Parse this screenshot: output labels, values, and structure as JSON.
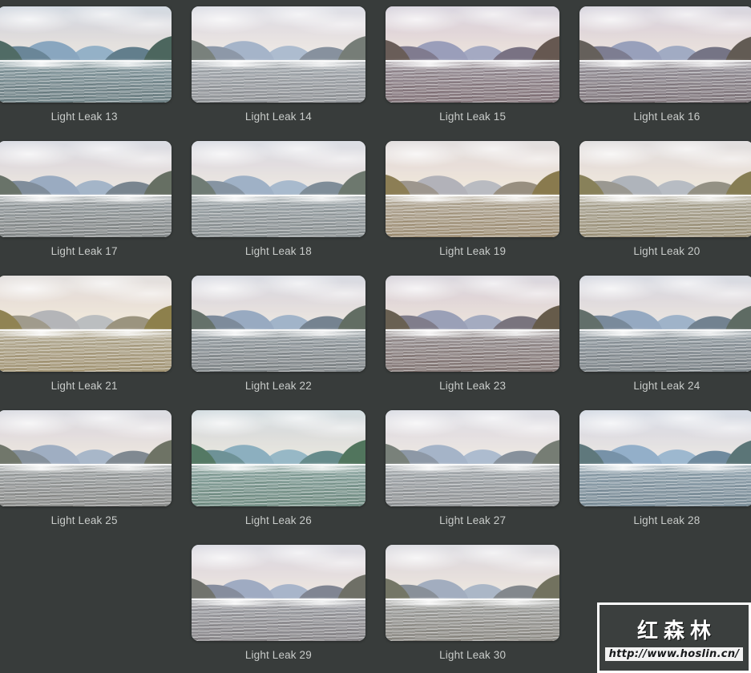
{
  "background_color": "#383c3b",
  "label_color": "#c9ccca",
  "gallery": {
    "columns": 4,
    "rows": 5,
    "items": [
      {
        "label": "Light Leak 13",
        "leak_color": "#b8fff0",
        "leak_pos": "72% 42%",
        "leak_size": "34%",
        "tone": "rgba(120,220,210,0.18)"
      },
      {
        "label": "Light Leak 14",
        "leak_color": "#ffffff",
        "leak_pos": "38% 48%",
        "leak_size": "95%",
        "tone": "rgba(255,240,235,0.30)"
      },
      {
        "label": "Light Leak 15",
        "leak_color": "#ff4d4d",
        "leak_pos": "26% 48%",
        "leak_size": "52%",
        "tone": "rgba(255,90,90,0.22)"
      },
      {
        "label": "Light Leak 16",
        "leak_color": "#ffffff",
        "leak_pos": "58% 42%",
        "leak_size": "58%",
        "tone": "rgba(255,120,120,0.20)"
      },
      {
        "label": "Light Leak 17",
        "leak_color": "#fff0c8",
        "leak_pos": "6% 55%",
        "leak_size": "60%",
        "tone": "rgba(255,235,200,0.22)"
      },
      {
        "label": "Light Leak 18",
        "leak_color": "#ffffff",
        "leak_pos": "78% 40%",
        "leak_size": "70%",
        "tone": "rgba(250,250,230,0.26)"
      },
      {
        "label": "Light Leak 19",
        "leak_color": "#ffc400",
        "leak_pos": "14% 40%",
        "leak_size": "62%",
        "tone": "rgba(255,170,40,0.40)"
      },
      {
        "label": "Light Leak 20",
        "leak_color": "#ffffff",
        "leak_pos": "16% 52%",
        "leak_size": "48%",
        "tone": "rgba(255,190,60,0.38)"
      },
      {
        "label": "Light Leak 21",
        "leak_color": "#ffd000",
        "leak_pos": "50% 72%",
        "leak_size": "56%",
        "tone": "rgba(255,180,30,0.42)"
      },
      {
        "label": "Light Leak 22",
        "leak_color": "#ffffff",
        "leak_pos": "18% 40%",
        "leak_size": "40%",
        "tone": "rgba(255,245,225,0.20)"
      },
      {
        "label": "Light Leak 23",
        "leak_color": "#ff6a2a",
        "leak_pos": "16% 46%",
        "leak_size": "34%",
        "tone": "rgba(255,110,50,0.22)"
      },
      {
        "label": "Light Leak 24",
        "leak_color": "#ffffff",
        "leak_pos": "22% 58%",
        "leak_size": "32%",
        "tone": "rgba(255,255,250,0.18)"
      },
      {
        "label": "Light Leak 25",
        "leak_color": "#ffffff",
        "leak_pos": "18% 62%",
        "leak_size": "62%",
        "tone": "rgba(255,225,180,0.26)"
      },
      {
        "label": "Light Leak 26",
        "leak_color": "#7dff9b",
        "leak_pos": "16% 55%",
        "leak_size": "30%",
        "tone": "rgba(110,235,140,0.26)"
      },
      {
        "label": "Light Leak 27",
        "leak_color": "#ffffff",
        "leak_pos": "44% 48%",
        "leak_size": "62%",
        "tone": "rgba(255,240,225,0.30)"
      },
      {
        "label": "Light Leak 28",
        "leak_color": "#bfe8ff",
        "leak_pos": "68% 58%",
        "leak_size": "55%",
        "tone": "rgba(150,215,255,0.28)"
      },
      {
        "label": "Light Leak 29",
        "leak_color": "#fff3d0",
        "leak_pos": "10% 58%",
        "leak_size": "48%",
        "tone": "rgba(255,200,190,0.26)"
      },
      {
        "label": "Light Leak 30",
        "leak_color": "#ffd98a",
        "leak_pos": "10% 60%",
        "leak_size": "44%",
        "tone": "rgba(255,205,140,0.28)"
      }
    ]
  },
  "watermark": {
    "brand": "红森林",
    "url": "http://www.hoslin.cn/"
  }
}
